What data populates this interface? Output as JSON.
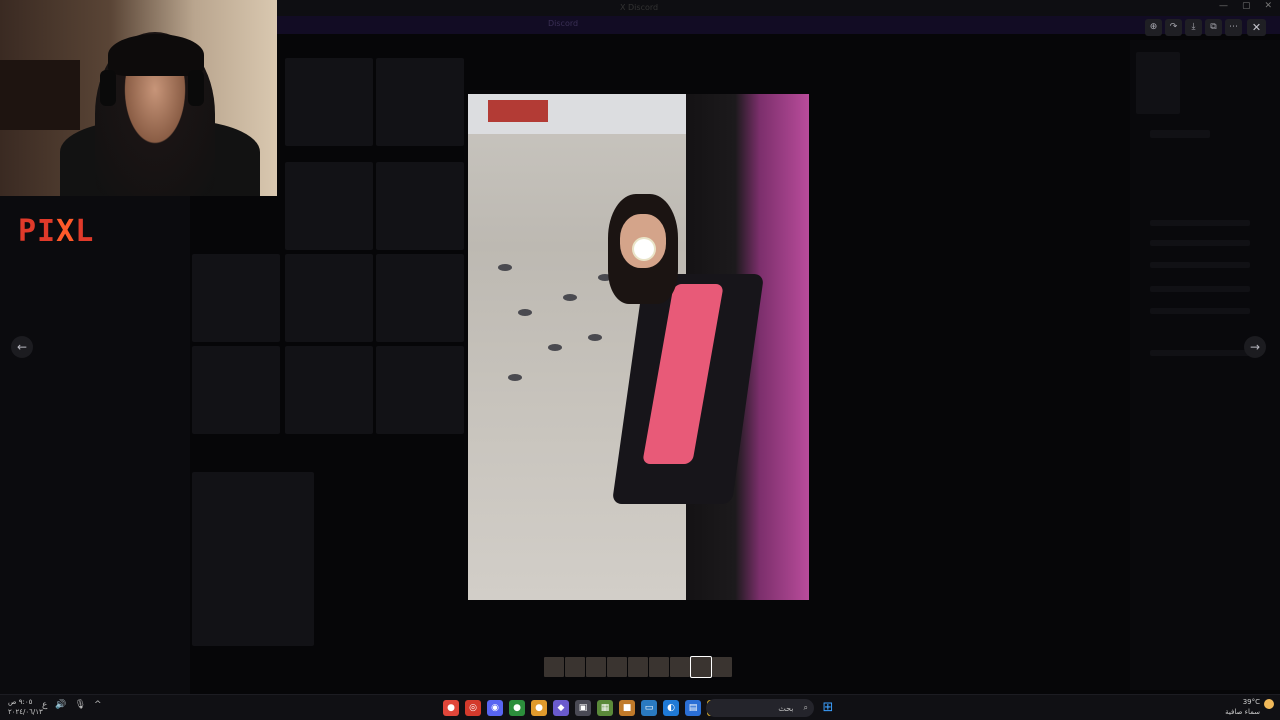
{
  "window": {
    "title": "X Discord",
    "controls": [
      "—",
      "▢",
      "✕"
    ]
  },
  "banner": {
    "text": "Discord"
  },
  "overlay": {
    "logo_left": "PI",
    "logo_x": "X",
    "logo_right": "L"
  },
  "lightbox": {
    "toolbar": [
      {
        "icon": "zoom-icon",
        "glyph": "⊕"
      },
      {
        "icon": "forward-icon",
        "glyph": "↷"
      },
      {
        "icon": "download-icon",
        "glyph": "⤓"
      },
      {
        "icon": "open-external-icon",
        "glyph": "⧉"
      },
      {
        "icon": "more-icon",
        "glyph": "⋯"
      }
    ],
    "close_glyph": "✕",
    "prev_glyph": "←",
    "next_glyph": "→",
    "thumbnails_count": 9,
    "active_thumbnail": 7
  },
  "taskbar": {
    "clock_time": "٩:٠٥ ص",
    "clock_date": "٢٠٢٤/٠٦/١٣",
    "tray": [
      "ع",
      "🔊",
      "🎙",
      "^"
    ],
    "search_placeholder": "بحث",
    "search_icon": "⌕",
    "weather_temp": "39°C",
    "weather_text": "سماء صافية",
    "apps": [
      {
        "name": "chrome-icon",
        "color": "#e0463a",
        "glyph": "●"
      },
      {
        "name": "browser-icon",
        "color": "#d33a2c",
        "glyph": "◎"
      },
      {
        "name": "discord-icon",
        "color": "#5865f2",
        "glyph": "◉"
      },
      {
        "name": "chrome2-icon",
        "color": "#2c8f3c",
        "glyph": "●"
      },
      {
        "name": "chrome3-icon",
        "color": "#e09a2c",
        "glyph": "●"
      },
      {
        "name": "controller-icon",
        "color": "#6a5acd",
        "glyph": "◆"
      },
      {
        "name": "gamepad-icon",
        "color": "#4a4a55",
        "glyph": "▣"
      },
      {
        "name": "minecraft-icon",
        "color": "#5a8a3a",
        "glyph": "▦"
      },
      {
        "name": "app-icon",
        "color": "#c07a2a",
        "glyph": "■"
      },
      {
        "name": "monitor-icon",
        "color": "#2a7ac0",
        "glyph": "▭"
      },
      {
        "name": "edge-icon",
        "color": "#1f7ad6",
        "glyph": "◐"
      },
      {
        "name": "calendar-icon",
        "color": "#2b6fd6",
        "glyph": "▤"
      },
      {
        "name": "folder-icon",
        "color": "#e0b32c",
        "glyph": "▬"
      },
      {
        "name": "explorer-icon",
        "color": "#3c3c44",
        "glyph": "▥"
      }
    ]
  }
}
